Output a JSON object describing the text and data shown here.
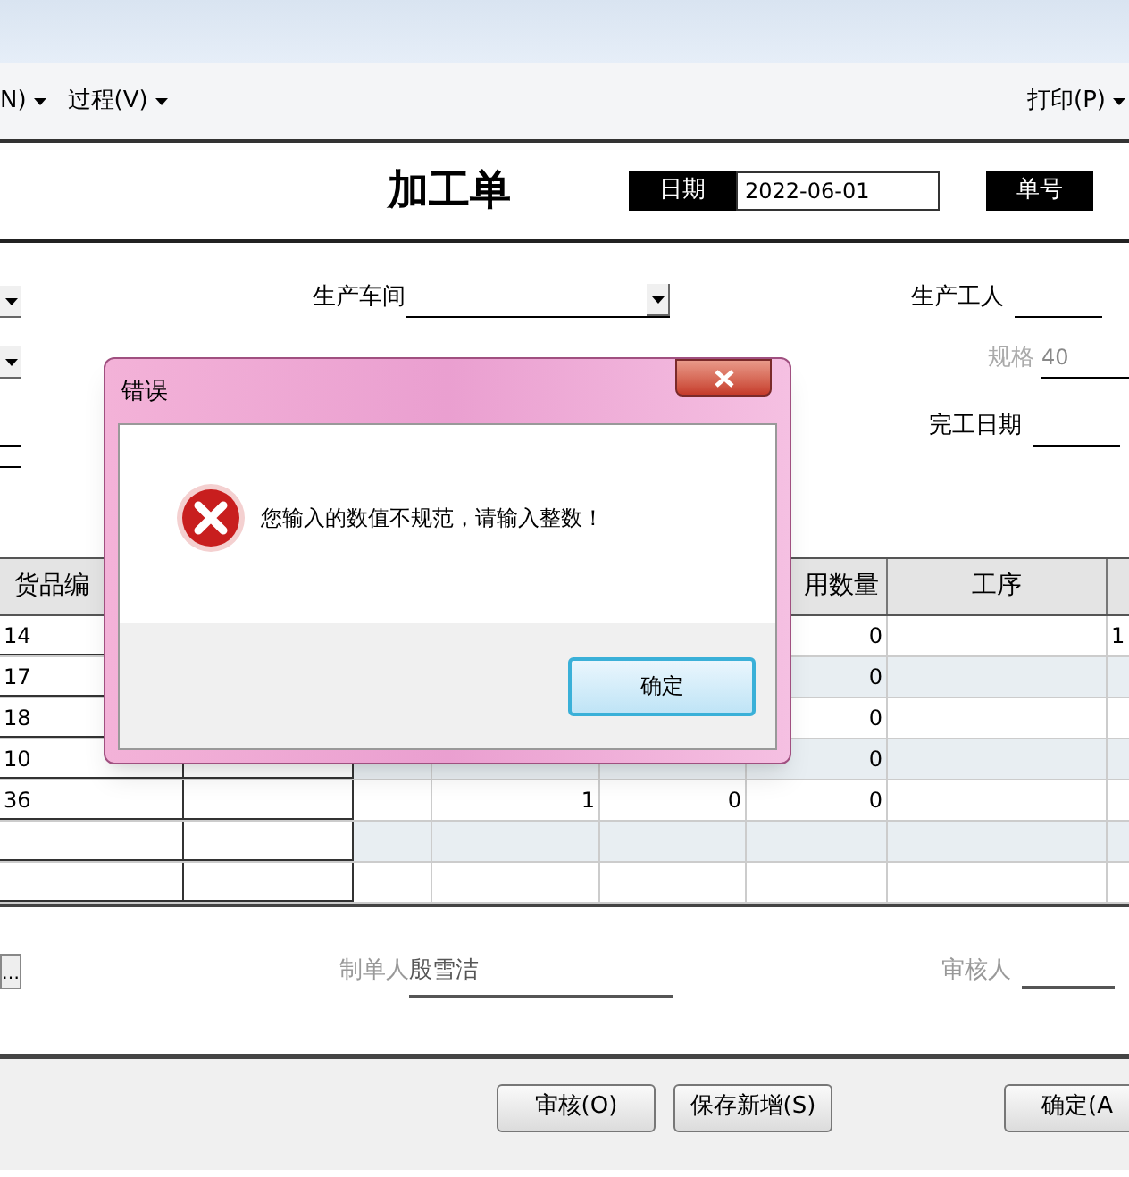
{
  "menu": [
    {
      "label": "N)"
    },
    {
      "label": "过程(V)"
    },
    {
      "label": "打印(P)"
    }
  ],
  "form": {
    "title": "加工单",
    "date_label": "日期",
    "date_value": "2022-06-01",
    "number_label": "单号"
  },
  "fields": {
    "workshop_label": "生产车间",
    "worker_label": "生产工人",
    "spec_label": "规格",
    "spec_value": "40",
    "finish_label": "完工日期"
  },
  "table": {
    "columns": [
      {
        "label": "货品编"
      },
      {},
      {},
      {},
      {},
      {
        "label": "用数量"
      },
      {
        "label": "工序"
      },
      {}
    ],
    "rows": [
      {
        "cells": [
          "14",
          null,
          null,
          null,
          null,
          "0",
          null,
          "1"
        ]
      },
      {
        "cells": [
          "17",
          null,
          null,
          null,
          null,
          "0",
          null,
          null
        ]
      },
      {
        "cells": [
          "18",
          null,
          null,
          null,
          null,
          "0",
          null,
          null
        ]
      },
      {
        "cells": [
          "10",
          null,
          null,
          null,
          null,
          "0",
          null,
          null
        ]
      },
      {
        "cells": [
          "36",
          null,
          null,
          "1",
          "0",
          "0",
          null,
          null
        ]
      },
      {
        "cells": [
          null,
          null,
          null,
          null,
          null,
          null,
          null,
          null
        ]
      },
      {
        "cells": [
          null,
          null,
          null,
          null,
          null,
          null,
          null,
          null
        ]
      }
    ]
  },
  "footer": {
    "more_button": "…",
    "maker_label": "制单人",
    "maker": "殷雪洁",
    "reviewer_label": "审核人"
  },
  "buttons": [
    "审核(O)",
    "保存新增(S)",
    "确定(A"
  ],
  "dialog": {
    "title": "错误",
    "message": "您输入的数值不规范，请输入整数！",
    "button": "确定"
  }
}
